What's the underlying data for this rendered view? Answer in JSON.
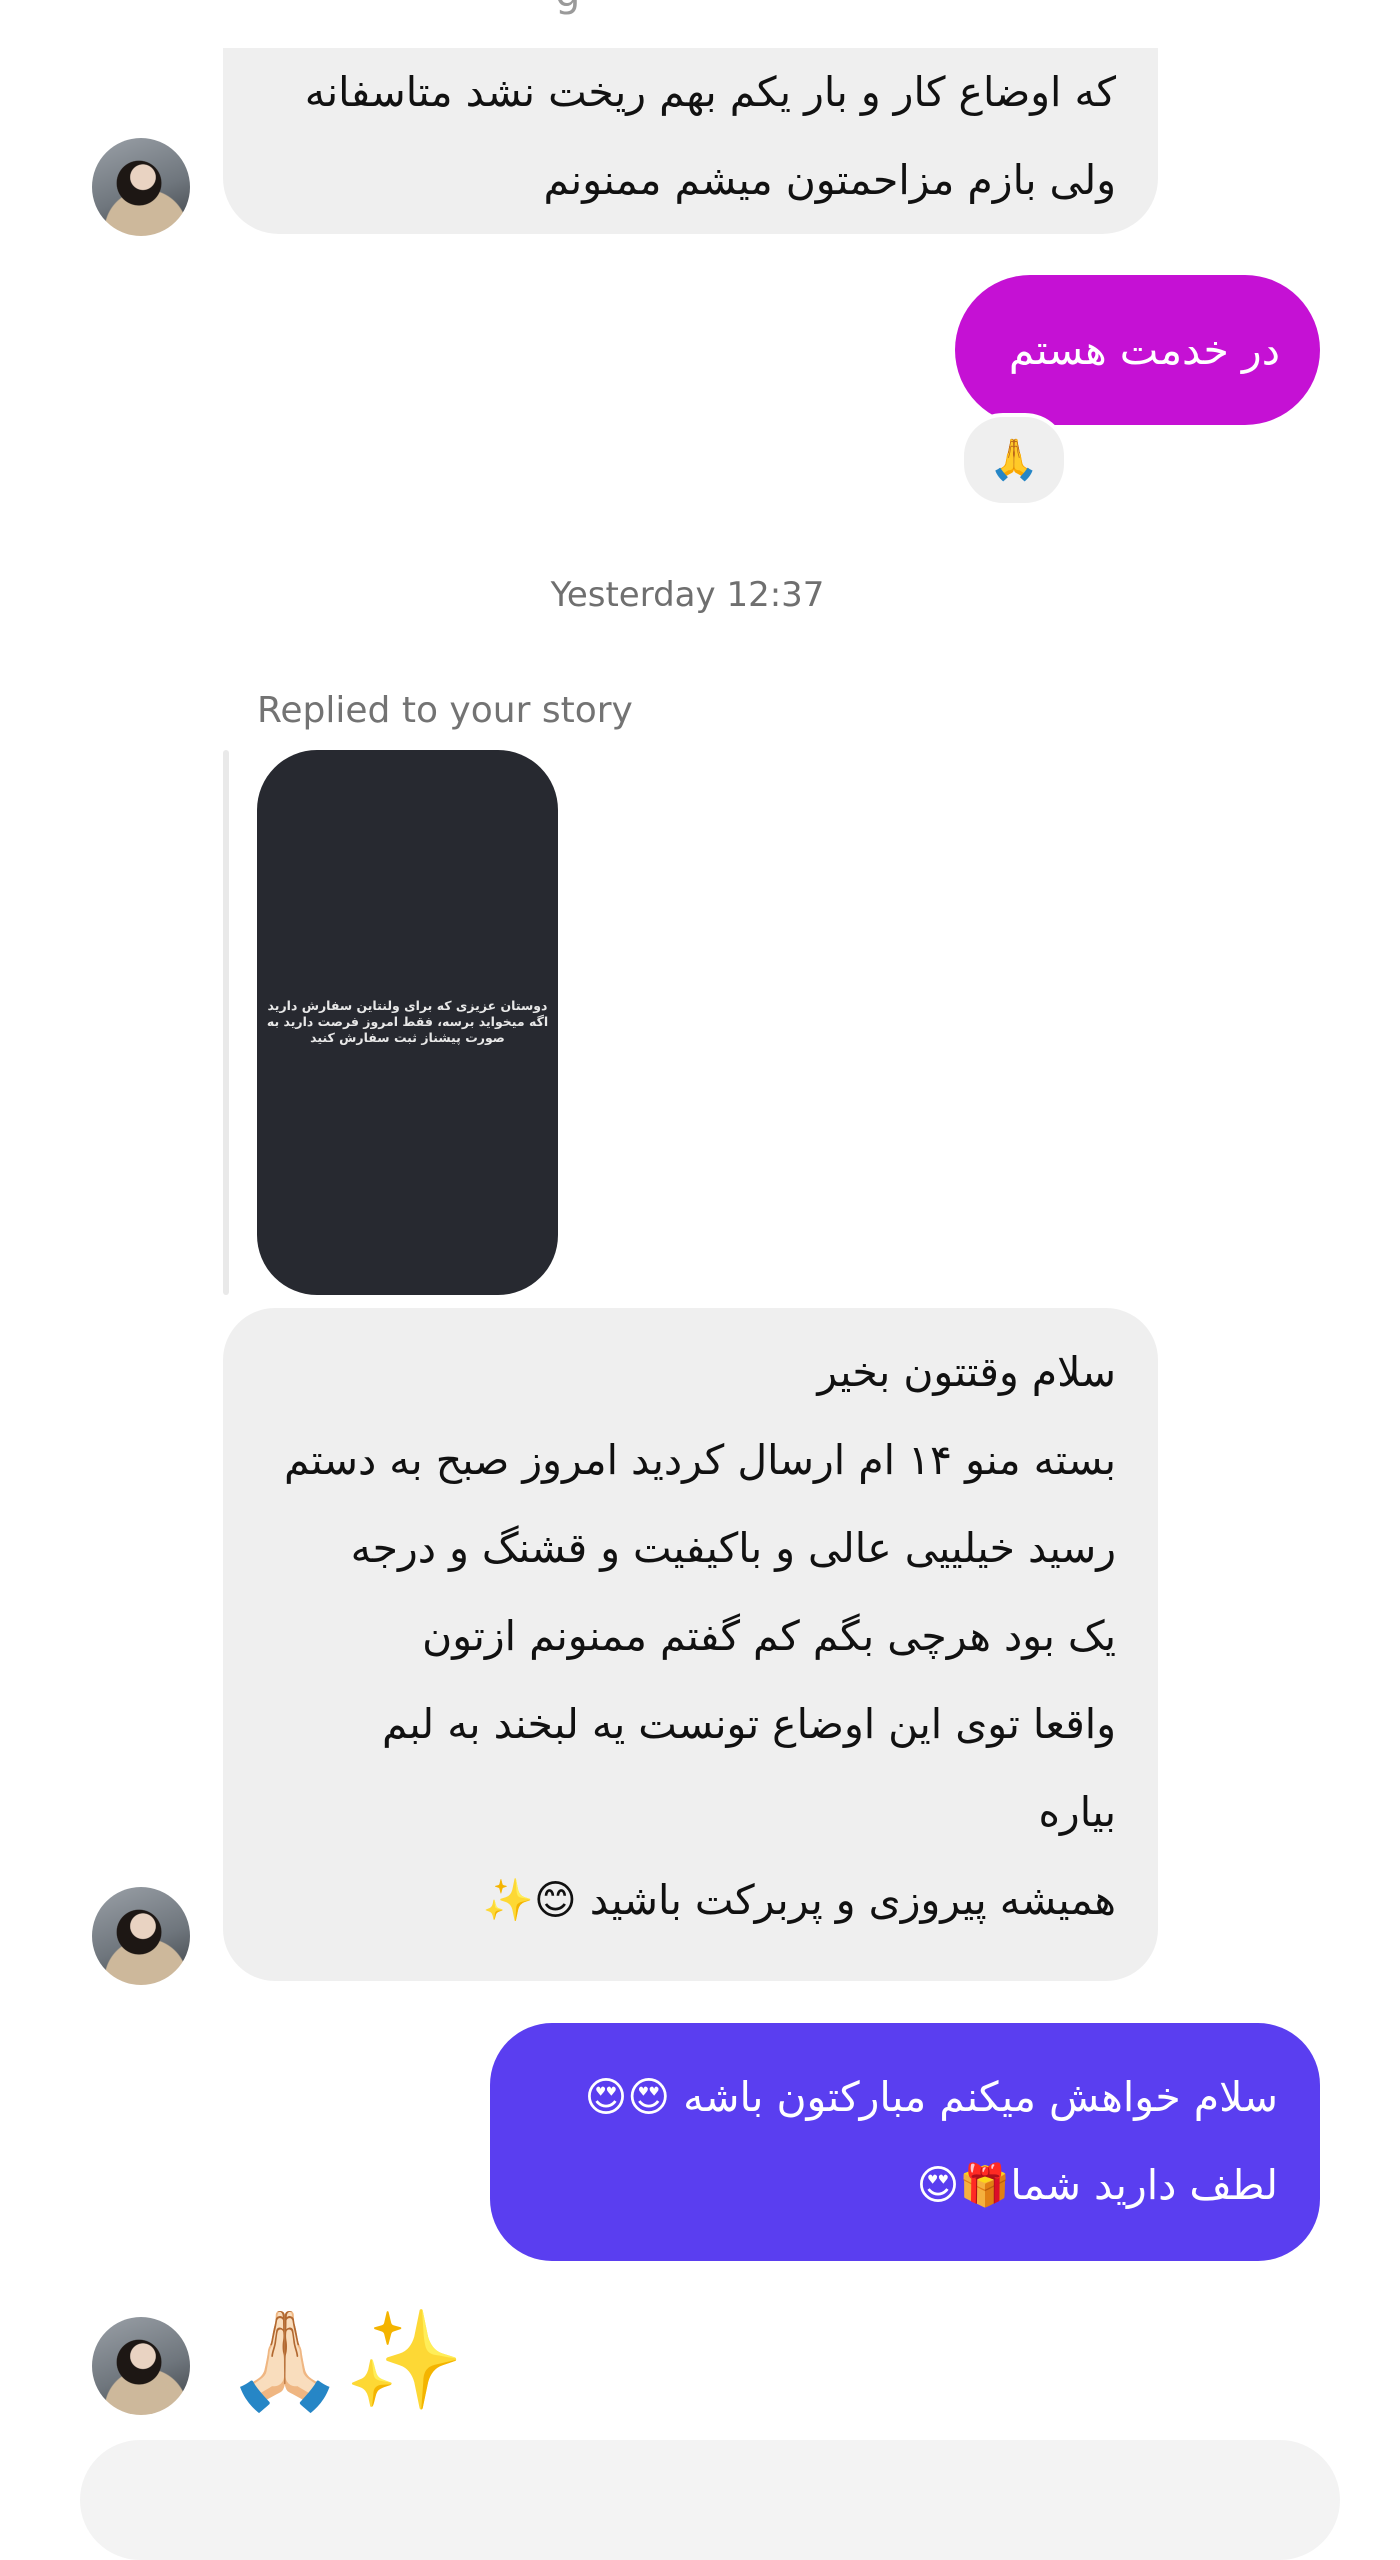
{
  "thread": {
    "top_partial": "g",
    "msg1": {
      "lines": [
        "که اوضاع کار و بار یکم بهم ریخت نشد متاسفانه",
        "ولی بازم مزاحمتون میشم ممنونم"
      ]
    },
    "msg2": {
      "text": "در خدمت هستم",
      "reaction": "🙏",
      "color": "#c511d4"
    },
    "timestamp": "Yesterday 12:37",
    "story_reply": {
      "label": "Replied to your story",
      "story_lines": [
        "دوستان عزیزی که برای ولنتاین سفارش دارید",
        "اگه میخواید برسه، فقط امروز فرصت دارید به",
        "صورت پیشناز ثبت سفارش کنید"
      ]
    },
    "msg3": {
      "lines": [
        "سلام وقتتون بخیر",
        "بسته منو ۱۴ ام ارسال کردید امروز صبح به دستم",
        "رسید خیلییی عالی و باکیفیت و قشنگ و درجه",
        "یک بود هرچی بگم کم گفتم ممنونم ازتون",
        "واقعا توی این اوضاع تونست یه لبخند به لبم",
        "بیاره",
        "همیشه پیروزی و پربرکت باشید 😊✨"
      ]
    },
    "msg4": {
      "lines": [
        "سلام خواهش میکنم مبارکتون باشه 😍😍",
        "لطف دارید شما🎁😍"
      ],
      "color": "#5a3ef0"
    },
    "msg5": {
      "emoji": "🙏🏻✨"
    }
  }
}
